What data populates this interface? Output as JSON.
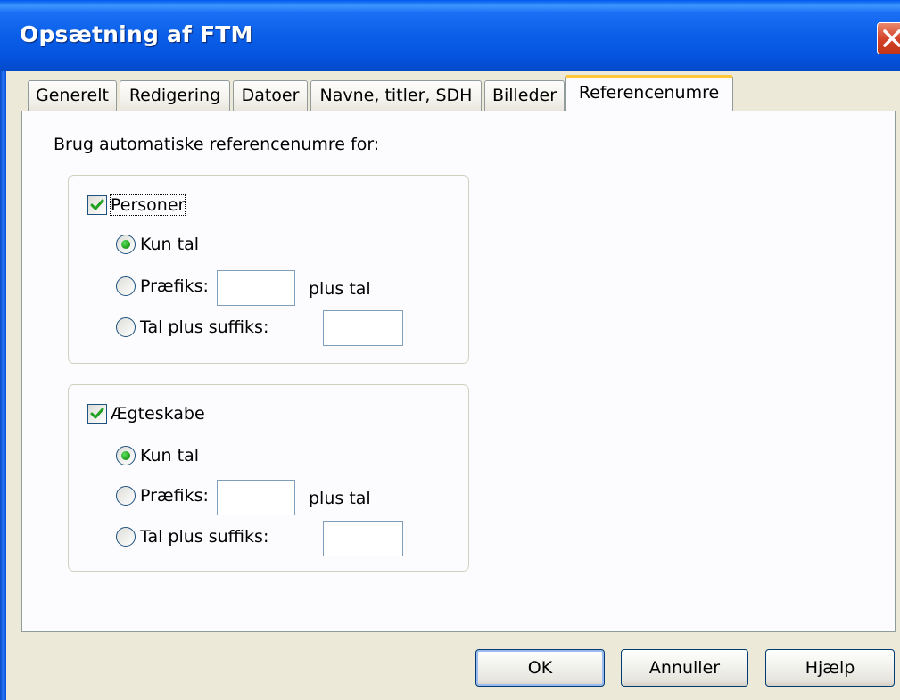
{
  "window": {
    "title": "Opsætning af FTM"
  },
  "tabs": [
    {
      "label": "Generelt"
    },
    {
      "label": "Redigering"
    },
    {
      "label": "Datoer"
    },
    {
      "label": "Navne, titler, SDH"
    },
    {
      "label": "Billeder"
    },
    {
      "label": "Referencenumre"
    }
  ],
  "active_tab": "Referencenumre",
  "panel": {
    "heading": "Brug automatiske referencenumre for:",
    "persons": {
      "checkbox_label": "Personer",
      "checked": true,
      "options": {
        "only_numbers": "Kun tal",
        "prefix": "Præfiks:",
        "prefix_suffix_text": "plus tal",
        "suffix": "Tal plus suffiks:"
      },
      "selected": "Kun tal",
      "prefix_value": "",
      "suffix_value": ""
    },
    "marriages": {
      "checkbox_label": "Ægteskabe",
      "checked": true,
      "options": {
        "only_numbers": "Kun tal",
        "prefix": "Præfiks:",
        "prefix_suffix_text": "plus tal",
        "suffix": "Tal plus suffiks:"
      },
      "selected": "Kun tal",
      "prefix_value": "",
      "suffix_value": ""
    }
  },
  "buttons": {
    "ok": "OK",
    "cancel": "Annuller",
    "help": "Hjælp"
  },
  "colors": {
    "titlebar": "#0553df",
    "close_button": "#d4442a",
    "active_tab_accent": "#ffc83c",
    "check_green": "#21a121",
    "dialog_bg": "#ece9d8"
  }
}
